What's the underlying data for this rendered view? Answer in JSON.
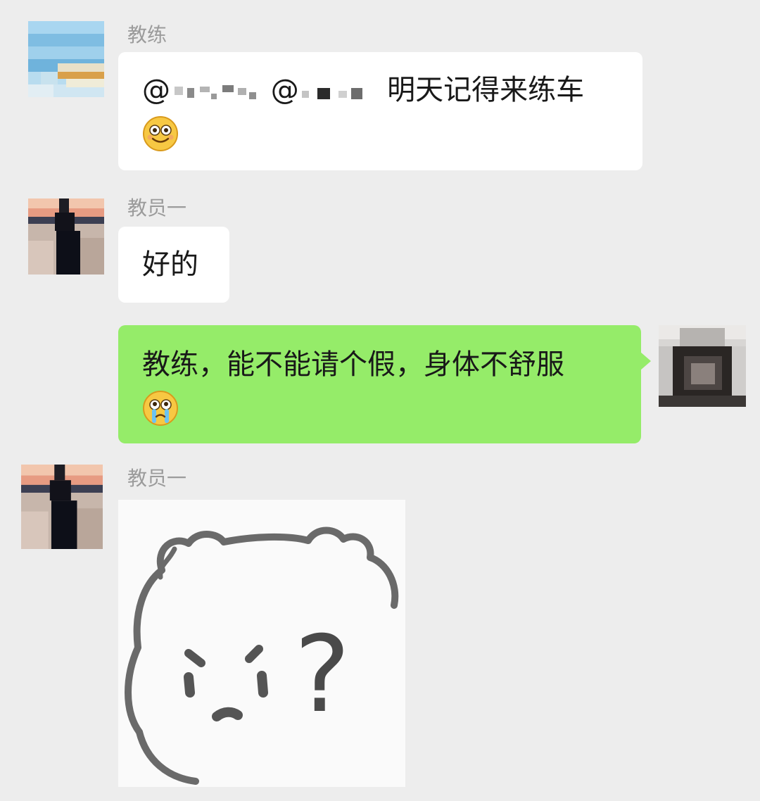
{
  "messages": [
    {
      "sender": "教练",
      "mention_prefix_1": "@",
      "mention_prefix_2": "@",
      "text": "明天记得来练车",
      "emoji": "smile-emoji"
    },
    {
      "sender": "教员一",
      "text": "好的"
    },
    {
      "self": true,
      "text": "教练，能不能请个假，身体不舒服",
      "emoji": "crying-emoji"
    },
    {
      "sender": "教员一",
      "sticker": "confused-bear-question-sticker",
      "sticker_text": "?"
    }
  ],
  "colors": {
    "background": "#ededed",
    "bubble_incoming": "#ffffff",
    "bubble_outgoing": "#95ec69",
    "sender_name": "#9b9b9b"
  }
}
